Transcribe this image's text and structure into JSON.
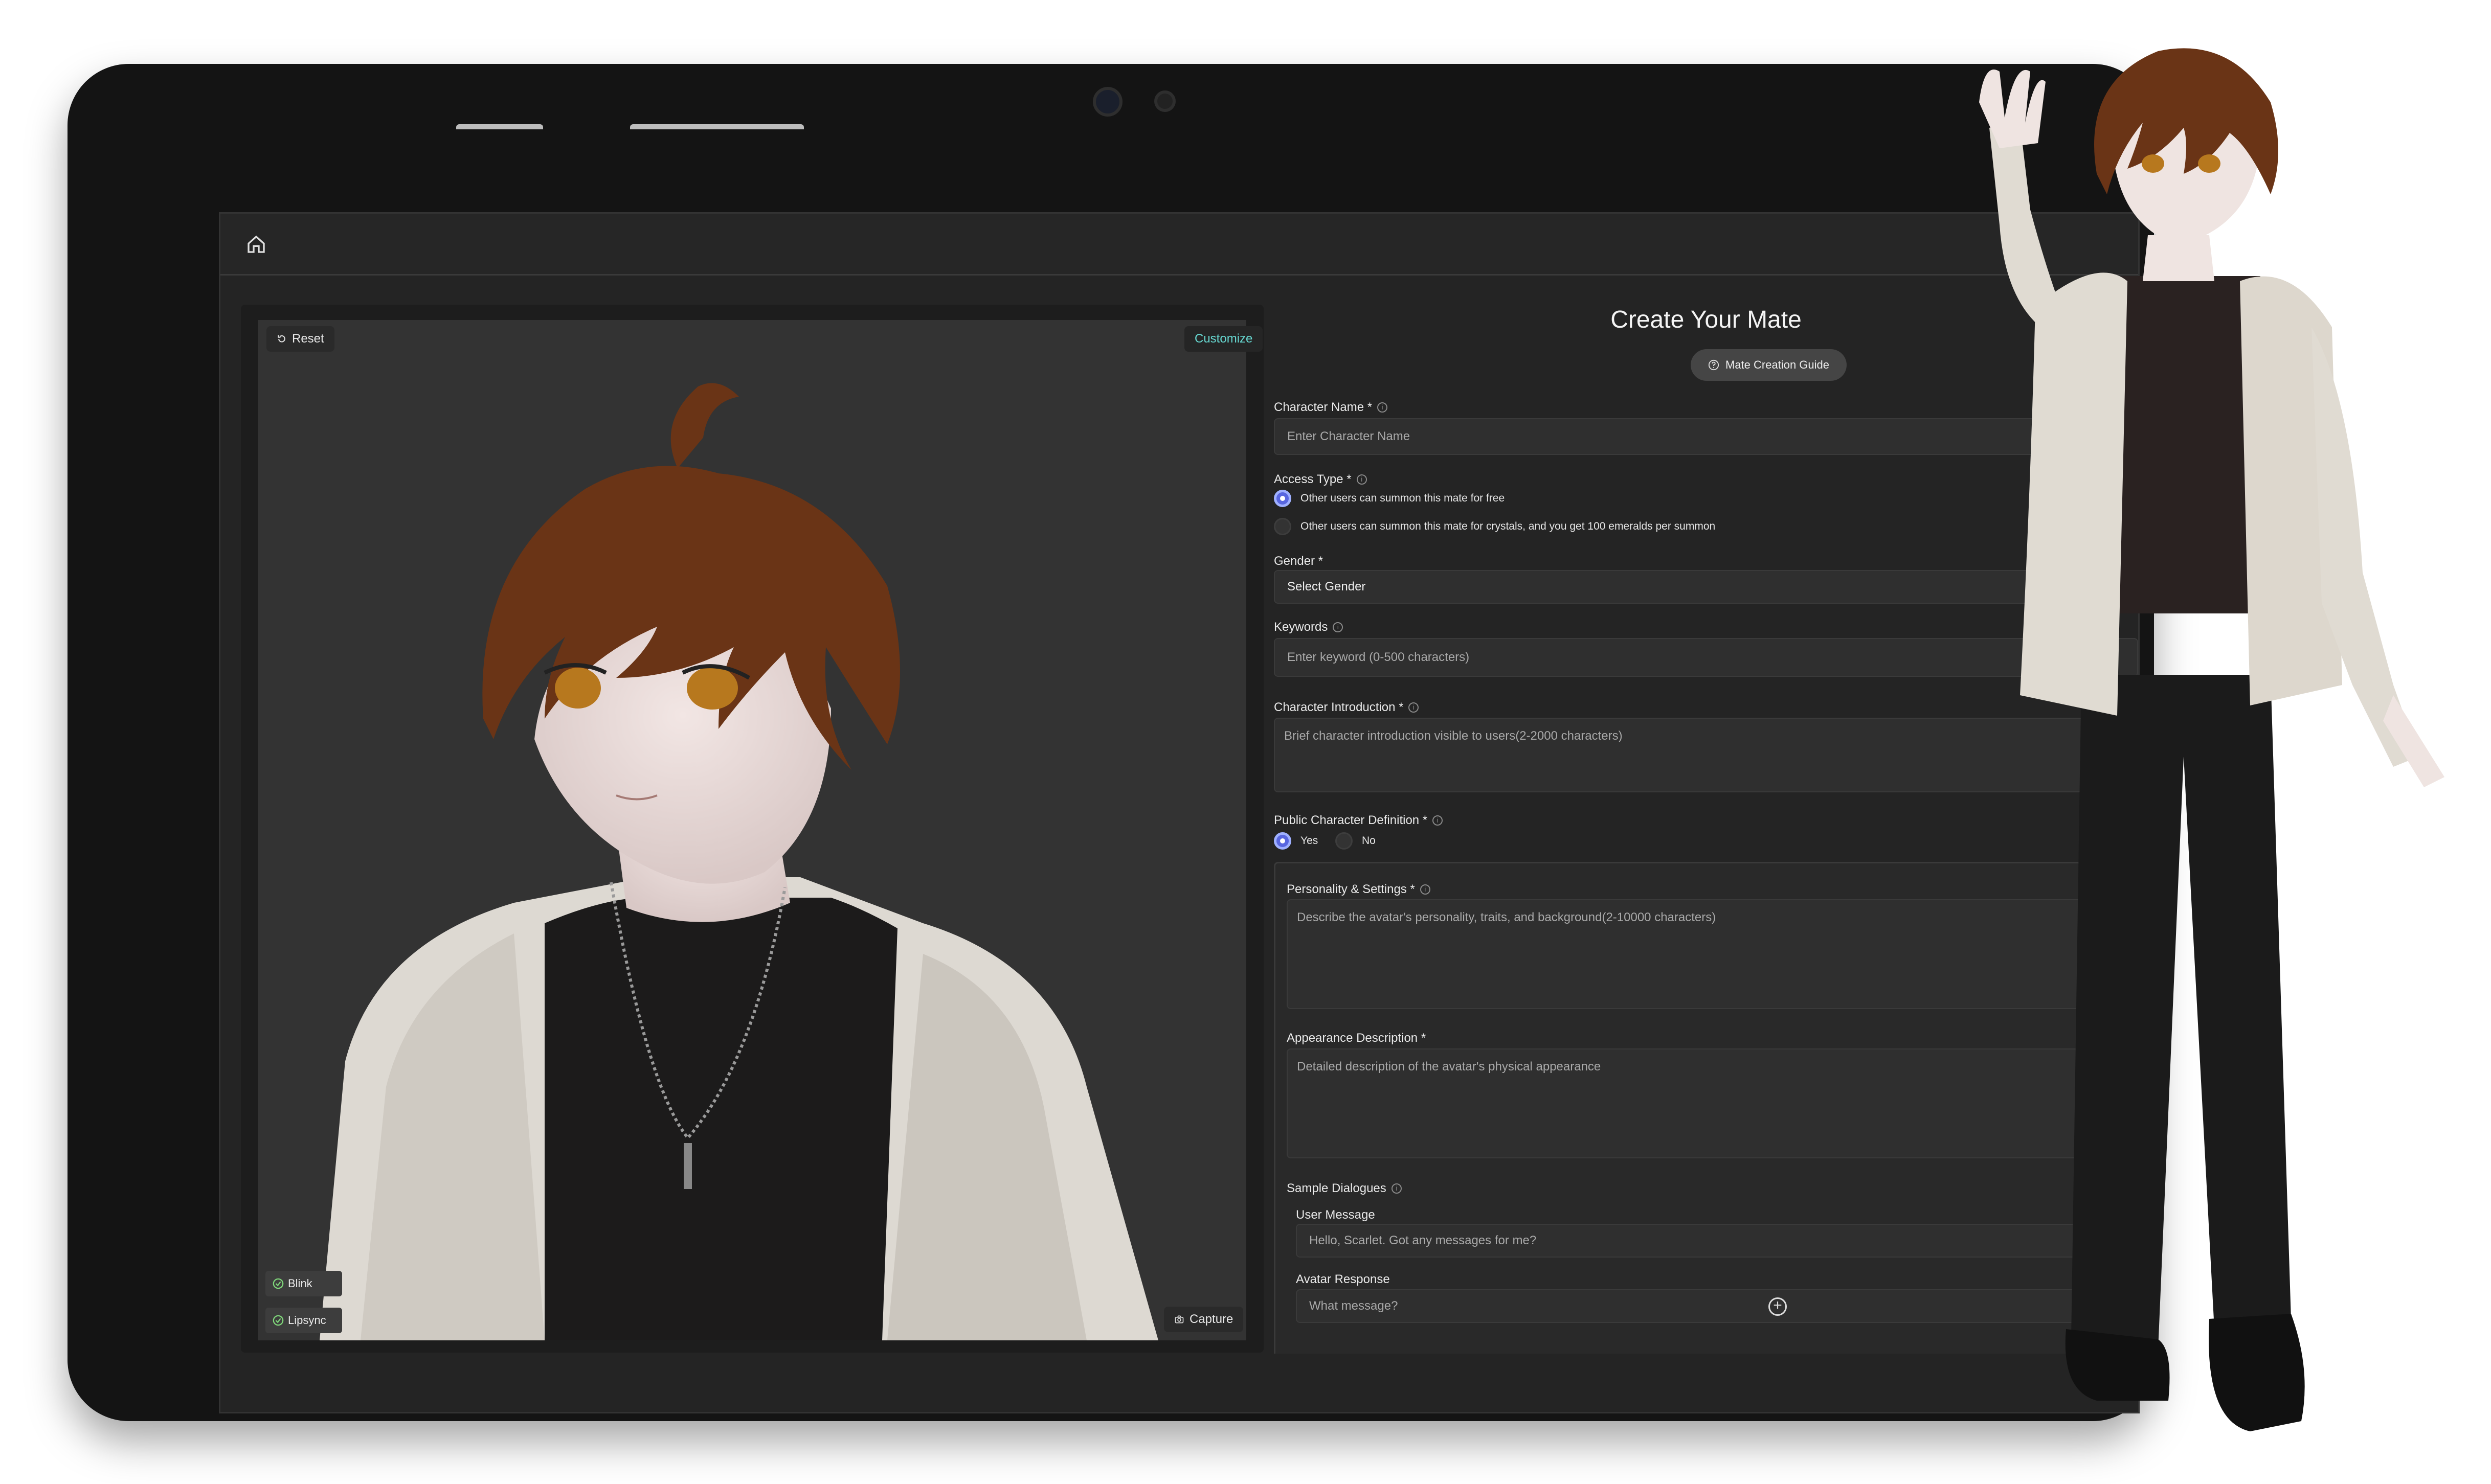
{
  "viewer": {
    "reset_label": "Reset",
    "customize_label": "Customize",
    "blink_label": "Blink",
    "lipsync_label": "Lipsync",
    "capture_label": "Capture"
  },
  "form": {
    "title": "Create Your Mate",
    "guide_button": "Mate Creation Guide",
    "character_name": {
      "label": "Character Name *",
      "placeholder": "Enter Character Name"
    },
    "access_type": {
      "label": "Access Type *",
      "options": [
        "Other users can summon this mate for free",
        "Other users can summon this mate for crystals, and you get 100 emeralds per summon"
      ],
      "selected_index": 0
    },
    "gender": {
      "label": "Gender *",
      "value": "Select Gender"
    },
    "keywords": {
      "label": "Keywords",
      "placeholder": "Enter keyword (0-500 characters)"
    },
    "introduction": {
      "label": "Character Introduction *",
      "placeholder": "Brief character introduction visible to users(2-2000 characters)"
    },
    "public_definition": {
      "label": "Public Character Definition *",
      "yes": "Yes",
      "no": "No",
      "selected": "Yes"
    },
    "personality": {
      "label": "Personality & Settings *",
      "placeholder": "Describe the avatar's personality, traits, and background(2-10000 characters)"
    },
    "appearance": {
      "label": "Appearance Description *",
      "placeholder": "Detailed description of the avatar's physical appearance"
    },
    "sample_dialogues": {
      "label": "Sample Dialogues",
      "user_label": "User Message",
      "user_placeholder": "Hello, Scarlet. Got any messages for me?",
      "avatar_label": "Avatar Response",
      "avatar_placeholder": "What message?"
    }
  },
  "colors": {
    "accent": "#5866e0",
    "customize": "#67d9d2",
    "background": "#242424"
  },
  "icons": [
    "home-icon",
    "reset-icon",
    "info-icon",
    "check-circle-icon",
    "camera-icon",
    "plus-circle-icon",
    "help-icon"
  ]
}
